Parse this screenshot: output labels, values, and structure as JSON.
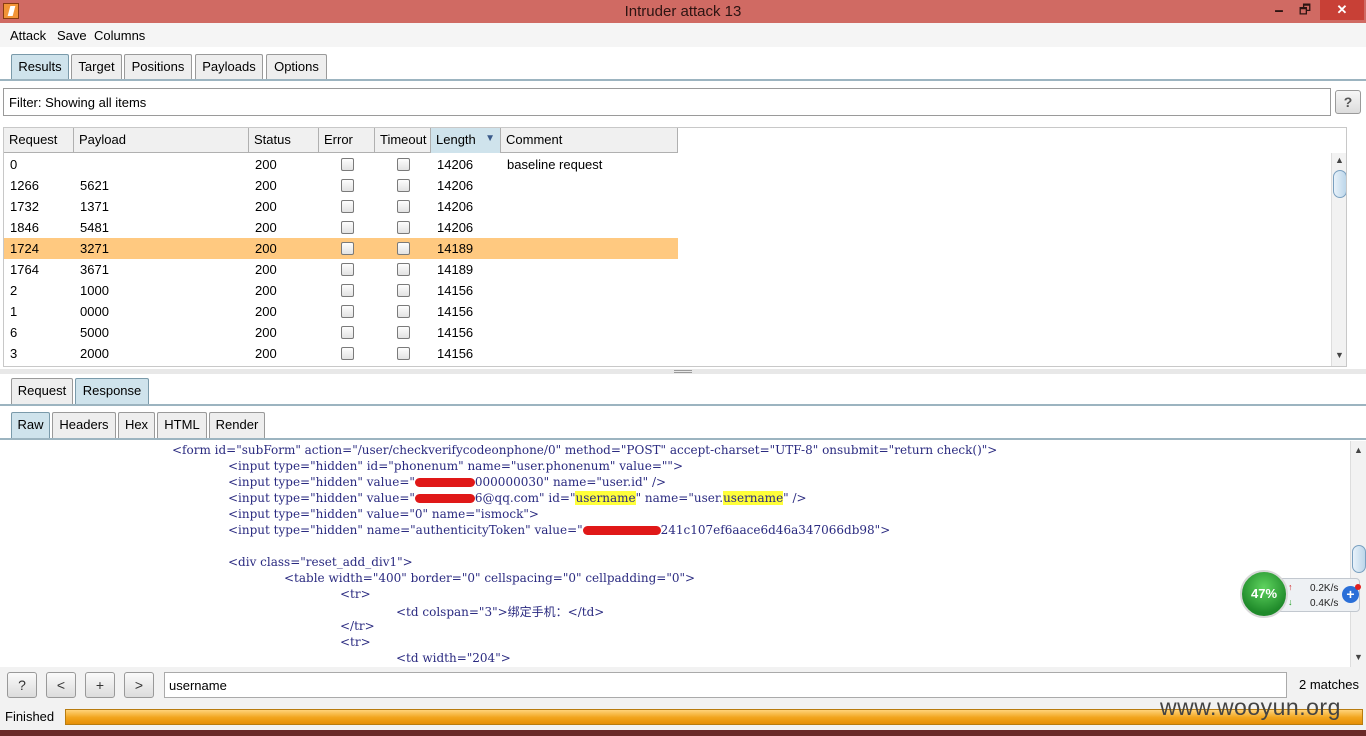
{
  "window": {
    "title": "Intruder attack 13",
    "minimize": "🗕",
    "maximize": "🗗",
    "close": "✕"
  },
  "menu": [
    "Attack",
    "Save",
    "Columns"
  ],
  "main_tabs": [
    "Results",
    "Target",
    "Positions",
    "Payloads",
    "Options"
  ],
  "filter": {
    "text": "Filter: Showing all items",
    "help": "?"
  },
  "table": {
    "columns": [
      "Request",
      "Payload",
      "Status",
      "Error",
      "Timeout",
      "Length",
      "Comment"
    ],
    "sorted_column": "Length",
    "rows": [
      {
        "request": "0",
        "payload": "",
        "status": "200",
        "error": false,
        "timeout": false,
        "length": "14206",
        "comment": "baseline request",
        "selected": false
      },
      {
        "request": "1266",
        "payload": "5621",
        "status": "200",
        "error": false,
        "timeout": false,
        "length": "14206",
        "comment": "",
        "selected": false
      },
      {
        "request": "1732",
        "payload": "1371",
        "status": "200",
        "error": false,
        "timeout": false,
        "length": "14206",
        "comment": "",
        "selected": false
      },
      {
        "request": "1846",
        "payload": "5481",
        "status": "200",
        "error": false,
        "timeout": false,
        "length": "14206",
        "comment": "",
        "selected": false
      },
      {
        "request": "1724",
        "payload": "3271",
        "status": "200",
        "error": false,
        "timeout": false,
        "length": "14189",
        "comment": "",
        "selected": true
      },
      {
        "request": "1764",
        "payload": "3671",
        "status": "200",
        "error": false,
        "timeout": false,
        "length": "14189",
        "comment": "",
        "selected": false
      },
      {
        "request": "2",
        "payload": "1000",
        "status": "200",
        "error": false,
        "timeout": false,
        "length": "14156",
        "comment": "",
        "selected": false
      },
      {
        "request": "1",
        "payload": "0000",
        "status": "200",
        "error": false,
        "timeout": false,
        "length": "14156",
        "comment": "",
        "selected": false
      },
      {
        "request": "6",
        "payload": "5000",
        "status": "200",
        "error": false,
        "timeout": false,
        "length": "14156",
        "comment": "",
        "selected": false
      },
      {
        "request": "3",
        "payload": "2000",
        "status": "200",
        "error": false,
        "timeout": false,
        "length": "14156",
        "comment": "",
        "selected": false
      }
    ]
  },
  "detail_tabs": [
    "Request",
    "Response"
  ],
  "view_tabs": [
    "Raw",
    "Headers",
    "Hex",
    "HTML",
    "Render"
  ],
  "code": {
    "line1": "<form id=\"subForm\" action=\"/user/checkverifycodeonphone/0\" method=\"POST\" accept-charset=\"UTF-8\" onsubmit=\"return check()\">",
    "line2": "<input type=\"hidden\" id=\"phonenum\" name=\"user.phonenum\" value=\"\">",
    "line3a": "<input type=\"hidden\" value=\"",
    "line3b": "000000030\" name=\"user.id\" />",
    "line4a": "<input type=\"hidden\" value=\"",
    "line4b": "6@qq.com\" id=\"",
    "line4c": "username",
    "line4d": "\" name=\"user.",
    "line4e": "username",
    "line4f": "\" />",
    "line5": "<input type=\"hidden\" value=\"0\" name=\"ismock\">",
    "line6a": "<input type=\"hidden\" name=\"authenticityToken\" value=\"",
    "line6b": "241c107ef6aace6d46a347066db98\">",
    "line7": "<div class=\"reset_add_div1\">",
    "line8": "<table width=\"400\" border=\"0\" cellspacing=\"0\" cellpadding=\"0\">",
    "line9": "<tr>",
    "line10": "<td colspan=\"3\">绑定手机：</td>",
    "line11": "</tr>",
    "line12": "<tr>",
    "line13": "<td width=\"204\">"
  },
  "search": {
    "help": "?",
    "prev": "<",
    "add": "+",
    "next": ">",
    "value": "username",
    "matches": "2 matches"
  },
  "status": {
    "text": "Finished",
    "progress_fraction": 1.0
  },
  "network_widget": {
    "percent": "47%",
    "up_rate": "0.2K/s",
    "down_rate": "0.4K/s"
  },
  "watermark": "www.wooyun.org",
  "colors": {
    "titlebar": "#d06a63",
    "selected_row": "#ffc980",
    "highlight": "#ffff3a",
    "progress": "#f1a41c"
  }
}
